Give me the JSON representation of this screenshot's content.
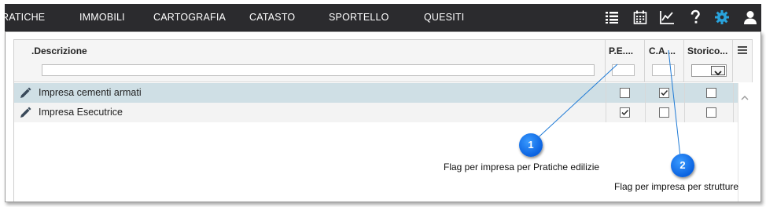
{
  "nav": {
    "items": [
      "RATICHE",
      "IMMOBILI",
      "CARTOGRAFIA",
      "CATASTO",
      "SPORTELLO",
      "QUESITI"
    ],
    "icons": [
      "list-icon",
      "calendar-icon",
      "chart-icon",
      "help-icon",
      "gear-icon",
      "user-icon"
    ],
    "gear_color": "#29a3dc"
  },
  "grid": {
    "columns": [
      ".Descrizione",
      "P.E....",
      "C.A....",
      "Storico..."
    ],
    "rows": [
      {
        "descrizione": "Impresa cementi armati",
        "pe": false,
        "ca": true,
        "storico": false
      },
      {
        "descrizione": "Impresa Esecutrice",
        "pe": true,
        "ca": false,
        "storico": false
      }
    ],
    "selected_row_color": "#cfdfe5"
  },
  "callouts": [
    {
      "number": "1",
      "text": "Flag per impresa  per Pratiche edilizie"
    },
    {
      "number": "2",
      "text": "Flag per impresa per strutture"
    }
  ]
}
